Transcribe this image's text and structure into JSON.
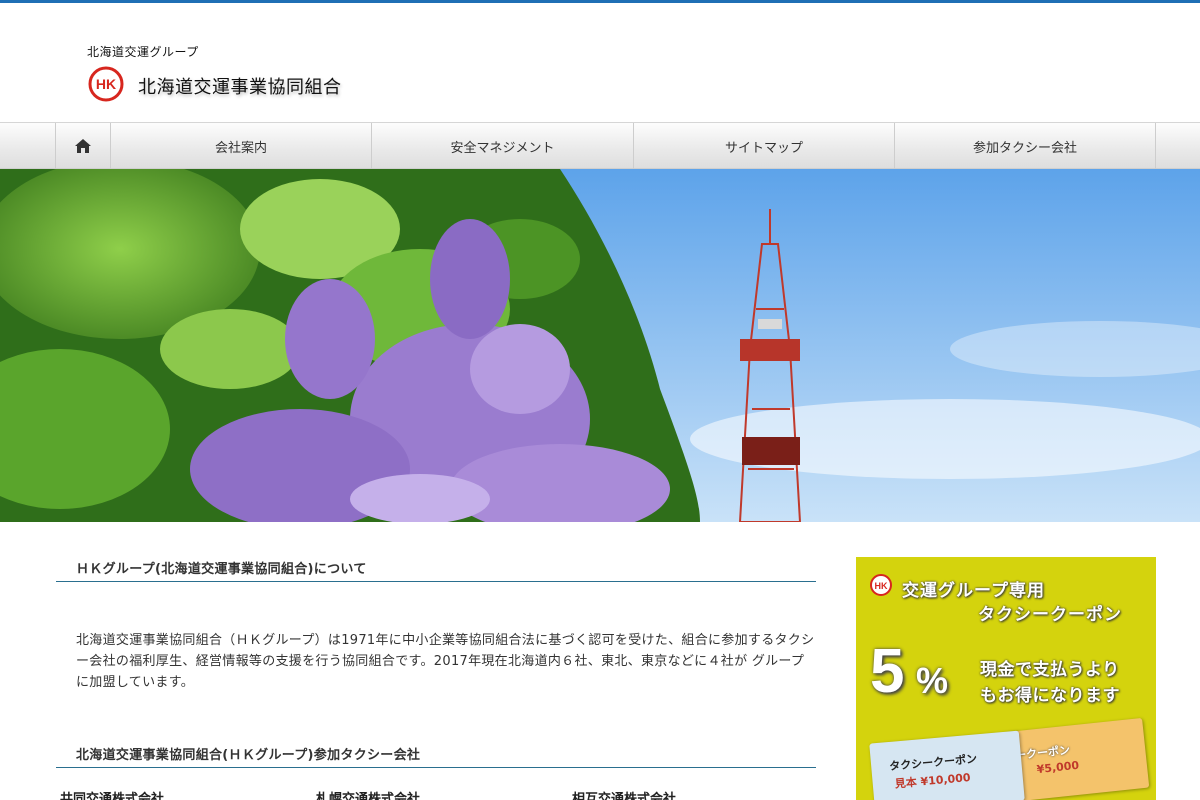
{
  "header": {
    "group_name": "北海道交運グループ",
    "site_title": "北海道交運事業協同組合",
    "logo_text": "HK"
  },
  "nav": {
    "home_icon": "home-icon",
    "items": [
      {
        "label": "会社案内"
      },
      {
        "label": "安全マネジメント"
      },
      {
        "label": "サイトマップ"
      },
      {
        "label": "参加タクシー会社"
      }
    ]
  },
  "main": {
    "about_heading": "ＨＫグループ(北海道交運事業協同組合)について",
    "about_text": "北海道交運事業協同組合（ＨＫグループ）は1971年に中小企業等協同組合法に基づく認可を受けた、組合に参加するタクシー会社の福利厚生、経営情報等の支援を行う協同組合です。2017年現在北海道内６社、東北、東京などに４社が グループに加盟しています。",
    "members_heading": "北海道交運事業協同組合(ＨＫグループ)参加タクシー会社",
    "companies": [
      "共同交通株式会社",
      "札幌交通株式会社",
      "相互交通株式会社"
    ]
  },
  "coupon": {
    "line1": "交運グループ専用",
    "line2": "タクシークーポン",
    "rate": "5",
    "percent": "%",
    "message1": "現金で支払うより",
    "message2": "もお得になります",
    "ticket1_title": "タクシークーポン",
    "ticket1_value": "見本 ¥10,000",
    "ticket2_title": "ークーポン",
    "ticket2_value": "¥5,000"
  },
  "colors": {
    "top_rule": "#1f6fb5",
    "heading_rule": "#2a6f8f",
    "coupon_bg": "#d4d30d",
    "logo_red": "#d7261e"
  }
}
